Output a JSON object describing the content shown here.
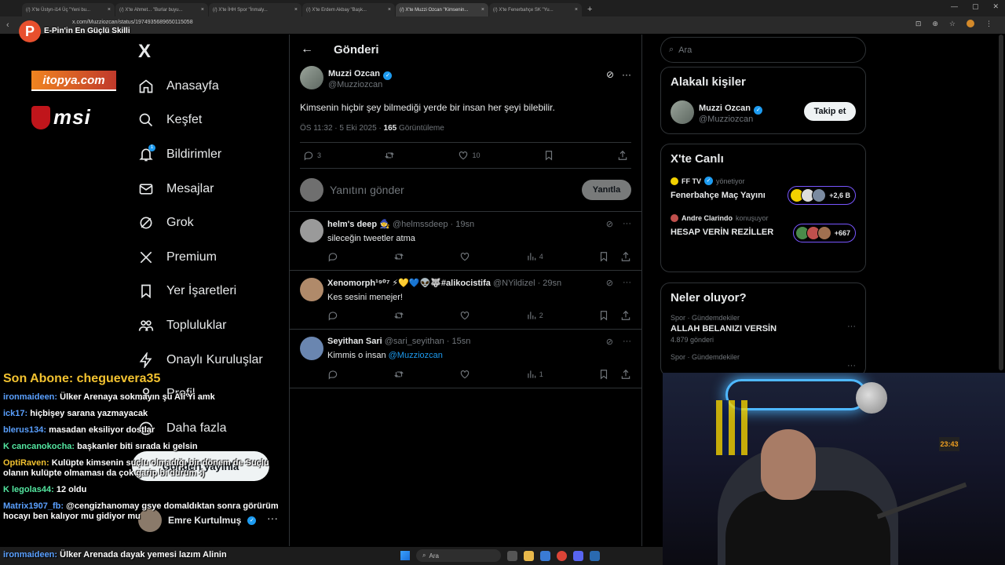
{
  "browser": {
    "tabs": [
      {
        "label": "(/) X'te Üstyn-i14 Üç \"Yeni bu...",
        "active": false
      },
      {
        "label": "(/) X'te Ahmet... \"Burlar buyu...",
        "active": false
      },
      {
        "label": "(/) X'te İHH Spor \"İnmaly...",
        "active": false
      },
      {
        "label": "(/) X'te Erdem Akbay \"Başk...",
        "active": false
      },
      {
        "label": "(/) X'te Muzzi Ozcan \"Kimsenin...",
        "active": true
      },
      {
        "label": "(/) X'te Fenerbahçe SK \"Yu...",
        "active": false
      }
    ],
    "new_tab": "+",
    "url": "x.com/Muzziozcan/status/1974935689650115058"
  },
  "overlay": {
    "logo_letter": "P",
    "slogan": "E-Pin'in En Güçlü Skilli",
    "sponsor1": "itopya.com",
    "sponsor2": "msi"
  },
  "sidebar": {
    "logo": "X",
    "items": [
      {
        "label": "Anasayfa",
        "icon": "home-icon"
      },
      {
        "label": "Keşfet",
        "icon": "search-icon"
      },
      {
        "label": "Bildirimler",
        "icon": "bell-icon",
        "badge": "1"
      },
      {
        "label": "Mesajlar",
        "icon": "mail-icon"
      },
      {
        "label": "Grok",
        "icon": "grok-icon"
      },
      {
        "label": "Premium",
        "icon": "x-icon"
      },
      {
        "label": "Yer İşaretleri",
        "icon": "bookmark-icon"
      },
      {
        "label": "Topluluklar",
        "icon": "communities-icon"
      },
      {
        "label": "Onaylı Kuruluşlar",
        "icon": "lightning-icon"
      },
      {
        "label": "Profil",
        "icon": "profile-icon"
      },
      {
        "label": "Daha fazla",
        "icon": "more-circle-icon"
      }
    ],
    "post_button": "Gönderi yayınla",
    "account_name": "Emre Kurtulmuş",
    "more": "···"
  },
  "main": {
    "back": "←",
    "title": "Gönderi",
    "tweet": {
      "name": "Muzzi Ozcan",
      "handle": "@Muzziozcan",
      "text": "Kimsenin hiçbir şey bilmediği yerde bir insan her şeyi bilebilir.",
      "time": "ÖS 11:32 · 5 Eki 2025 · ",
      "views": "165",
      "views_label": " Görüntüleme",
      "replies": "3",
      "retweets": "",
      "likes": "10"
    },
    "reply_placeholder": "Yanıtını gönder",
    "reply_button": "Yanıtla",
    "replies": [
      {
        "name": "helm's deep",
        "emoji": "🧙",
        "handle": "@helmssdeep · 19sn",
        "text": "sileceğin tweetler atma",
        "views": "4",
        "color": "#9a9a9a"
      },
      {
        "name": "Xenomorph¹⁹⁰⁷ ⚡💛💙👽🐺#alikocistifa",
        "emoji": "",
        "handle": "@NYildizel · 29sn",
        "text": "Kes sesini menejer!",
        "views": "2",
        "color": "#b08a6a"
      },
      {
        "name": "Seyithan Sari",
        "emoji": "",
        "handle": "@sari_seyithan · 15sn",
        "text": "Kimmis o insan ",
        "mention": "@Muzziozcan",
        "views": "1",
        "color": "#6a86b0"
      }
    ]
  },
  "right": {
    "search_placeholder": "Ara",
    "related_title": "Alakalı kişiler",
    "related_name": "Muzzi Ozcan",
    "related_handle": "@Muzziozcan",
    "follow": "Takip et",
    "live_title": "X'te Canlı",
    "live": [
      {
        "host": "FF TV",
        "role": "yönetiyor",
        "title": "Fenerbahçe Maç Yayını",
        "count": "+2,6 B"
      },
      {
        "host": "Andre Clarindo",
        "role": "konuşuyor",
        "title": "HESAP VERİN REZİLLER",
        "count": "+667"
      }
    ],
    "trends_title": "Neler oluyor?",
    "trends": [
      {
        "category": "Spor · Gündemdekiler",
        "title": "ALLAH BELANIZI VERSİN",
        "count": "4.879 gönderi"
      },
      {
        "category": "Spor · Gündemdekiler",
        "title": "",
        "count": ""
      }
    ]
  },
  "chat": {
    "last_sub": "Son Abone: cheguevera35",
    "messages": [
      {
        "user": "ironmaideen:",
        "text": " Ülker Arenaya sokmayın şu Ali'Yi amk",
        "color": "#5aa0ff"
      },
      {
        "user": "ick17:",
        "text": " hiçbişey sarana yazmayacak",
        "color": "#5aa0ff"
      },
      {
        "user": "blerus134:",
        "text": " masadan eksiliyor dostlar",
        "color": "#5aa0ff"
      },
      {
        "user": "K cancanokocha:",
        "text": " başkanler biti sırada ki gelsin",
        "color": "#53e6a0"
      },
      {
        "user": "OptiRaven:",
        "text": " Kulüpte kimsenin suçlu olmadığı bir dönem de Suçlu olanın kulüpte olmaması da çok garip bi durum :)",
        "color": "#f2c230"
      },
      {
        "user": "K legolas44:",
        "text": " 12 oldu",
        "color": "#53e6a0"
      },
      {
        "user": "Matrix1907_fb:",
        "text": " @cengizhanomay gsye domaldıktan sonra görürüm hocayı ben kalıyor mu gidiyor mu",
        "color": "#5aa0ff"
      }
    ],
    "bottom_user": "ironmaideen:",
    "bottom_text": " Ülker Arenada dayak yemesi lazım Alinin"
  },
  "cam": {
    "clock": "23:43"
  },
  "taskbar": {
    "search": "Ara"
  }
}
